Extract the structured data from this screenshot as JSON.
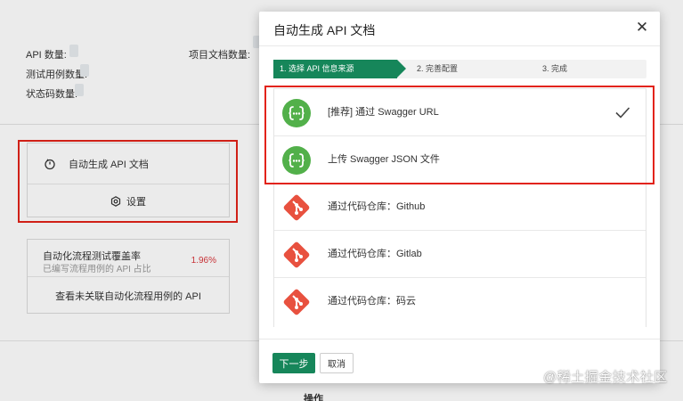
{
  "background": {
    "stats": {
      "api_count_label": "API 数量:",
      "test_case_count_label": "测试用例数量:",
      "status_code_count_label": "状态码数量:",
      "project_doc_count_label": "项目文档数量:"
    },
    "auto_generate_label": "自动生成 API 文档",
    "settings_label": "设置",
    "coverage": {
      "title": "自动化流程测试覆盖率",
      "subtitle": "已编写流程用例的 API 占比",
      "percent": "1.96%",
      "link": "查看未关联自动化流程用例的 API"
    },
    "operations_header": "操作"
  },
  "modal": {
    "title": "自动生成 API 文档",
    "close_glyph": "✕",
    "steps": [
      {
        "label": "1. 选择 API 信息来源",
        "active": true
      },
      {
        "label": "2. 完善配置",
        "active": false
      },
      {
        "label": "3. 完成",
        "active": false
      }
    ],
    "sources": [
      {
        "label": "[推荐] 通过 Swagger URL",
        "icon": "swagger-icon",
        "selected": true
      },
      {
        "label": "上传 Swagger JSON 文件",
        "icon": "swagger-icon",
        "selected": false
      },
      {
        "label": "通过代码仓库：Github",
        "icon": "git-icon",
        "selected": false
      },
      {
        "label": "通过代码仓库：Gitlab",
        "icon": "git-icon",
        "selected": false
      },
      {
        "label": "通过代码仓库：码云",
        "icon": "git-icon",
        "selected": false
      }
    ],
    "next_button": "下一步",
    "cancel_button": "取消"
  },
  "watermark": "@稀土掘金技术社区",
  "colors": {
    "primary_green": "#16865a",
    "swagger_green": "#52b04a",
    "git_red": "#e8513f",
    "highlight_red": "#e2231a",
    "percent_red": "#d9373c"
  }
}
